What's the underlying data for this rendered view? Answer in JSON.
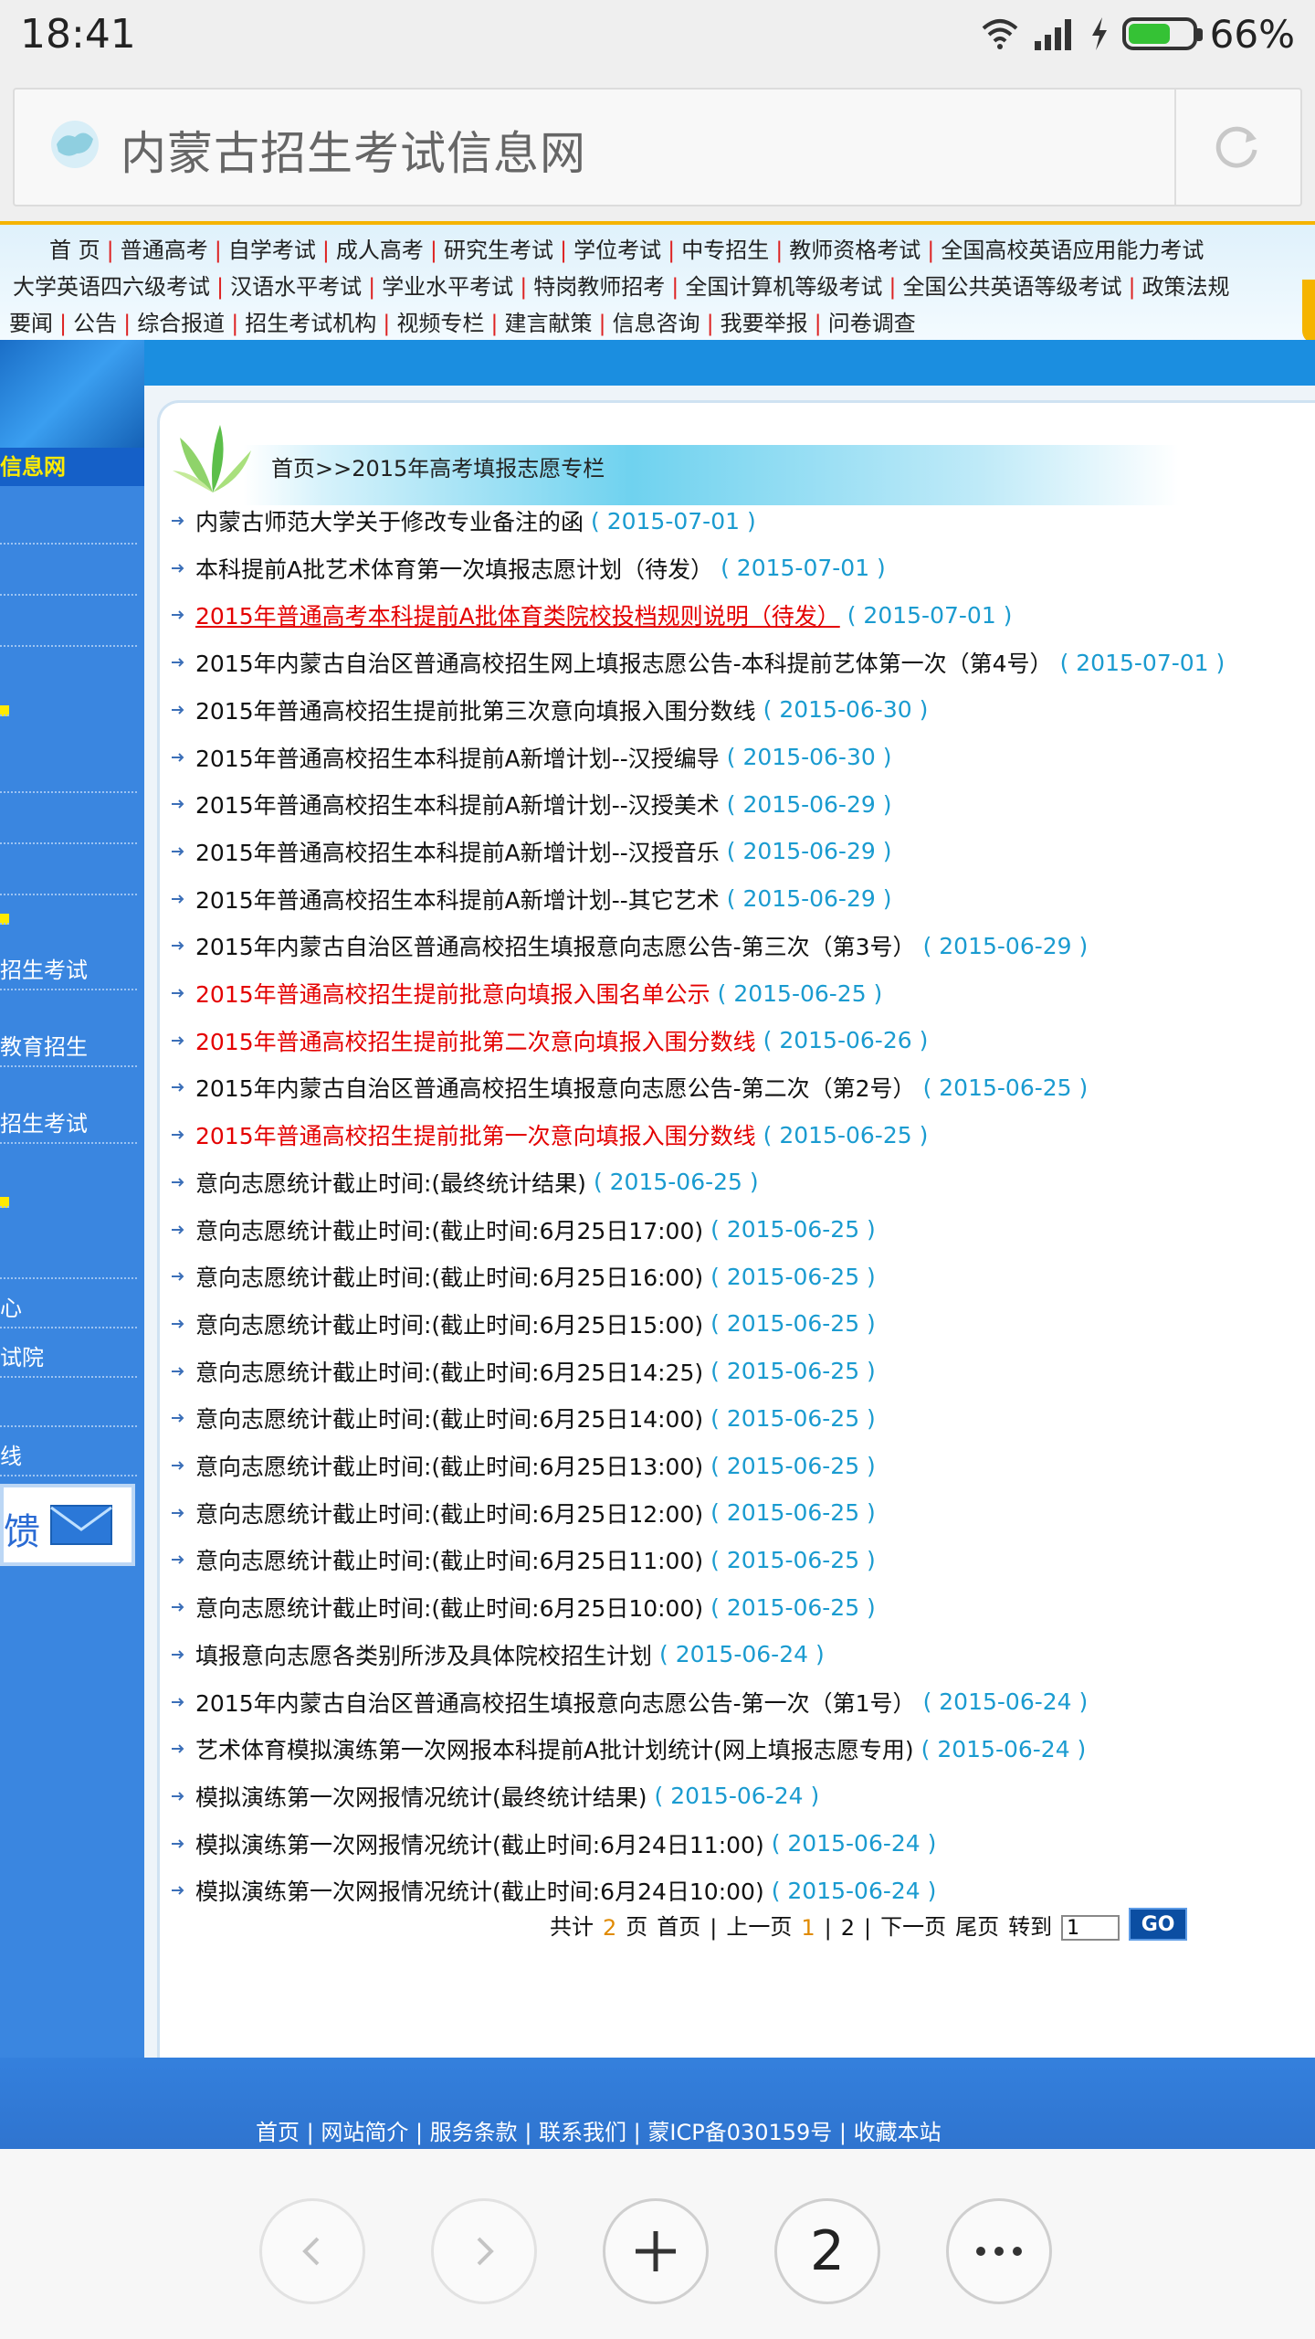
{
  "status": {
    "time": "18:41",
    "battery": "66%",
    "battery_level": 0.66
  },
  "browser": {
    "page_title": "内蒙古招生考试信息网",
    "tab_count": "2"
  },
  "nav": {
    "row1": [
      "首 页",
      "普通高考",
      "自学考试",
      "成人高考",
      "研究生考试",
      "学位考试",
      "中专招生",
      "教师资格考试",
      "全国高校英语应用能力考试"
    ],
    "row2": [
      "大学英语四六级考试",
      "汉语水平考试",
      "学业水平考试",
      "特岗教师招考",
      "全国计算机等级考试",
      "全国公共英语等级考试",
      "政策法规"
    ],
    "row3": [
      "要闻",
      "公告",
      "综合报道",
      "招生考试机构",
      "视频专栏",
      "建言献策",
      "信息咨询",
      "我要举报",
      "问卷调查"
    ]
  },
  "sidebar": {
    "title": "信息网",
    "items": [
      "招生考试",
      "教育招生",
      "招生考试",
      "心",
      "试院",
      "线"
    ],
    "feedback": "馈"
  },
  "breadcrumb": "首页>>2015年高考填报志愿专栏",
  "articles": [
    {
      "title": "内蒙古师范大学关于修改专业备注的函",
      "date": "( 2015-07-01 )",
      "style": "normal"
    },
    {
      "title": "本科提前A批艺术体育第一次填报志愿计划（待发）",
      "date": "( 2015-07-01 )",
      "style": "normal"
    },
    {
      "title": "2015年普通高考本科提前A批体育类院校投档规则说明（待发）",
      "date": "( 2015-07-01 )",
      "style": "red-underline"
    },
    {
      "title": "2015年内蒙古自治区普通高校招生网上填报志愿公告-本科提前艺体第一次（第4号）",
      "date": "( 2015-07-01 )",
      "style": "normal"
    },
    {
      "title": "2015年普通高校招生提前批第三次意向填报入围分数线",
      "date": "( 2015-06-30 )",
      "style": "normal"
    },
    {
      "title": "2015年普通高校招生本科提前A新增计划--汉授编导",
      "date": "( 2015-06-30 )",
      "style": "normal"
    },
    {
      "title": "2015年普通高校招生本科提前A新增计划--汉授美术",
      "date": "( 2015-06-29 )",
      "style": "normal"
    },
    {
      "title": "2015年普通高校招生本科提前A新增计划--汉授音乐",
      "date": "( 2015-06-29 )",
      "style": "normal"
    },
    {
      "title": "2015年普通高校招生本科提前A新增计划--其它艺术",
      "date": "( 2015-06-29 )",
      "style": "normal"
    },
    {
      "title": "2015年内蒙古自治区普通高校招生填报意向志愿公告-第三次（第3号）",
      "date": "( 2015-06-29 )",
      "style": "normal"
    },
    {
      "title": "2015年普通高校招生提前批意向填报入围名单公示",
      "date": "( 2015-06-25 )",
      "style": "red"
    },
    {
      "title": "2015年普通高校招生提前批第二次意向填报入围分数线",
      "date": "( 2015-06-26 )",
      "style": "red"
    },
    {
      "title": "2015年内蒙古自治区普通高校招生填报意向志愿公告-第二次（第2号）",
      "date": "( 2015-06-25 )",
      "style": "normal"
    },
    {
      "title": "2015年普通高校招生提前批第一次意向填报入围分数线",
      "date": "( 2015-06-25 )",
      "style": "red"
    },
    {
      "title": "意向志愿统计截止时间:(最终统计结果)",
      "date": "( 2015-06-25 )",
      "style": "normal"
    },
    {
      "title": "意向志愿统计截止时间:(截止时间:6月25日17:00)",
      "date": "( 2015-06-25 )",
      "style": "normal"
    },
    {
      "title": "意向志愿统计截止时间:(截止时间:6月25日16:00)",
      "date": "( 2015-06-25 )",
      "style": "normal"
    },
    {
      "title": "意向志愿统计截止时间:(截止时间:6月25日15:00)",
      "date": "( 2015-06-25 )",
      "style": "normal"
    },
    {
      "title": "意向志愿统计截止时间:(截止时间:6月25日14:25)",
      "date": "( 2015-06-25 )",
      "style": "normal"
    },
    {
      "title": "意向志愿统计截止时间:(截止时间:6月25日14:00)",
      "date": "( 2015-06-25 )",
      "style": "normal"
    },
    {
      "title": "意向志愿统计截止时间:(截止时间:6月25日13:00)",
      "date": "( 2015-06-25 )",
      "style": "normal"
    },
    {
      "title": "意向志愿统计截止时间:(截止时间:6月25日12:00)",
      "date": "( 2015-06-25 )",
      "style": "normal"
    },
    {
      "title": "意向志愿统计截止时间:(截止时间:6月25日11:00)",
      "date": "( 2015-06-25 )",
      "style": "normal"
    },
    {
      "title": "意向志愿统计截止时间:(截止时间:6月25日10:00)",
      "date": "( 2015-06-25 )",
      "style": "normal"
    },
    {
      "title": "填报意向志愿各类别所涉及具体院校招生计划",
      "date": "( 2015-06-24 )",
      "style": "normal"
    },
    {
      "title": "2015年内蒙古自治区普通高校招生填报意向志愿公告-第一次（第1号）",
      "date": "( 2015-06-24 )",
      "style": "normal"
    },
    {
      "title": "艺术体育模拟演练第一次网报本科提前A批计划统计(网上填报志愿专用)",
      "date": "( 2015-06-24 )",
      "style": "normal"
    },
    {
      "title": "模拟演练第一次网报情况统计(最终统计结果)",
      "date": "( 2015-06-24 )",
      "style": "normal"
    },
    {
      "title": "模拟演练第一次网报情况统计(截止时间:6月24日11:00)",
      "date": "( 2015-06-24 )",
      "style": "normal"
    },
    {
      "title": "模拟演练第一次网报情况统计(截止时间:6月24日10:00)",
      "date": "( 2015-06-24 )",
      "style": "normal"
    }
  ],
  "pager": {
    "total_prefix": "共计",
    "total_pages": "2",
    "total_suffix": "页",
    "first": "首页",
    "prev": "上一页",
    "page1": "1",
    "page2": "2",
    "next": "下一页",
    "last": "尾页",
    "goto_label": "转到",
    "goto_value": "1",
    "go": "GO"
  },
  "footer": {
    "links": "首页 | 网站简介 | 服务条款 | 联系我们 | 蒙ICP备030159号 | 收藏本站"
  },
  "colors": {
    "link_red": "#e40000",
    "date_blue": "#1a9bd0",
    "sidebar_blue": "#3a86e0",
    "nav_accent": "#f5b400"
  }
}
